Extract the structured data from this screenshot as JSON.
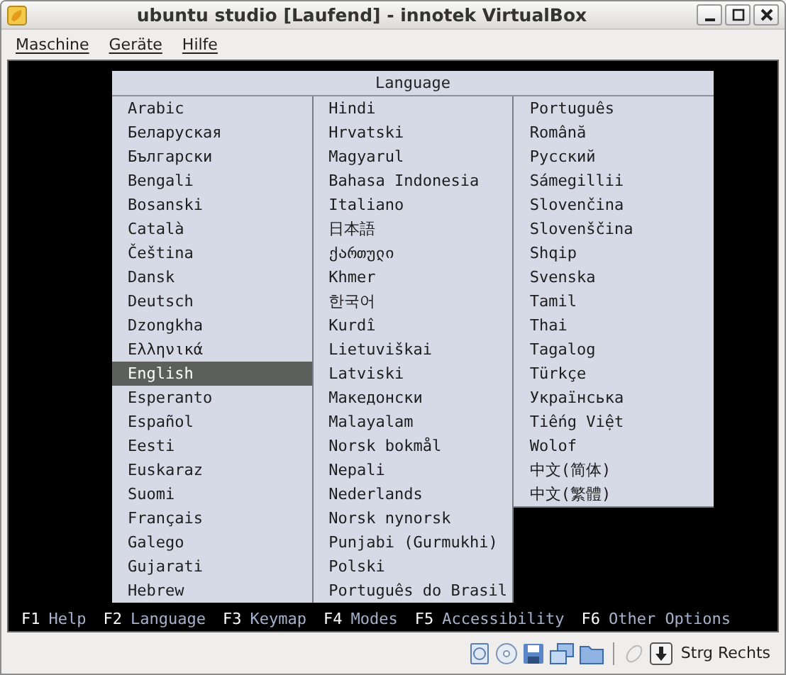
{
  "window": {
    "title": "ubuntu studio [Laufend] - innotek VirtualBox"
  },
  "menu": [
    "Maschine",
    "Geräte",
    "Hilfe"
  ],
  "language_menu": {
    "title": "Language",
    "columns": [
      [
        {
          "label": "Arabic",
          "selected": false
        },
        {
          "label": "Беларуская",
          "selected": false
        },
        {
          "label": "Български",
          "selected": false
        },
        {
          "label": "Bengali",
          "selected": false
        },
        {
          "label": "Bosanski",
          "selected": false
        },
        {
          "label": "Català",
          "selected": false
        },
        {
          "label": "Čeština",
          "selected": false
        },
        {
          "label": "Dansk",
          "selected": false
        },
        {
          "label": "Deutsch",
          "selected": false
        },
        {
          "label": "Dzongkha",
          "selected": false
        },
        {
          "label": "Ελληνικά",
          "selected": false
        },
        {
          "label": "English",
          "selected": true
        },
        {
          "label": "Esperanto",
          "selected": false
        },
        {
          "label": "Español",
          "selected": false
        },
        {
          "label": "Eesti",
          "selected": false
        },
        {
          "label": "Euskaraz",
          "selected": false
        },
        {
          "label": "Suomi",
          "selected": false
        },
        {
          "label": "Français",
          "selected": false
        },
        {
          "label": "Galego",
          "selected": false
        },
        {
          "label": "Gujarati",
          "selected": false
        },
        {
          "label": "Hebrew",
          "selected": false
        }
      ],
      [
        {
          "label": "Hindi",
          "selected": false
        },
        {
          "label": "Hrvatski",
          "selected": false
        },
        {
          "label": "Magyarul",
          "selected": false
        },
        {
          "label": "Bahasa Indonesia",
          "selected": false
        },
        {
          "label": "Italiano",
          "selected": false
        },
        {
          "label": "日本語",
          "selected": false
        },
        {
          "label": "ქართული",
          "selected": false
        },
        {
          "label": "Khmer",
          "selected": false
        },
        {
          "label": "한국어",
          "selected": false
        },
        {
          "label": "Kurdî",
          "selected": false
        },
        {
          "label": "Lietuviškai",
          "selected": false
        },
        {
          "label": "Latviski",
          "selected": false
        },
        {
          "label": "Македонски",
          "selected": false
        },
        {
          "label": "Malayalam",
          "selected": false
        },
        {
          "label": "Norsk bokmål",
          "selected": false
        },
        {
          "label": "Nepali",
          "selected": false
        },
        {
          "label": "Nederlands",
          "selected": false
        },
        {
          "label": "Norsk nynorsk",
          "selected": false
        },
        {
          "label": "Punjabi (Gurmukhi)",
          "selected": false
        },
        {
          "label": "Polski",
          "selected": false
        },
        {
          "label": "Português do Brasil",
          "selected": false
        }
      ],
      [
        {
          "label": "Português",
          "selected": false
        },
        {
          "label": "Română",
          "selected": false
        },
        {
          "label": "Русский",
          "selected": false
        },
        {
          "label": "Sámegillii",
          "selected": false
        },
        {
          "label": "Slovenčina",
          "selected": false
        },
        {
          "label": "Slovenščina",
          "selected": false
        },
        {
          "label": "Shqip",
          "selected": false
        },
        {
          "label": "Svenska",
          "selected": false
        },
        {
          "label": "Tamil",
          "selected": false
        },
        {
          "label": "Thai",
          "selected": false
        },
        {
          "label": "Tagalog",
          "selected": false
        },
        {
          "label": "Türkçe",
          "selected": false
        },
        {
          "label": "Українська",
          "selected": false
        },
        {
          "label": "Tiếng Việt",
          "selected": false
        },
        {
          "label": "Wolof",
          "selected": false
        },
        {
          "label": "中文(简体)",
          "selected": false
        },
        {
          "label": "中文(繁體)",
          "selected": false
        }
      ]
    ]
  },
  "function_keys": [
    {
      "key": "F1",
      "label": "Help"
    },
    {
      "key": "F2",
      "label": "Language"
    },
    {
      "key": "F3",
      "label": "Keymap"
    },
    {
      "key": "F4",
      "label": "Modes"
    },
    {
      "key": "F5",
      "label": "Accessibility"
    },
    {
      "key": "F6",
      "label": "Other Options"
    }
  ],
  "status_bar": {
    "host_key": "Strg Rechts"
  }
}
